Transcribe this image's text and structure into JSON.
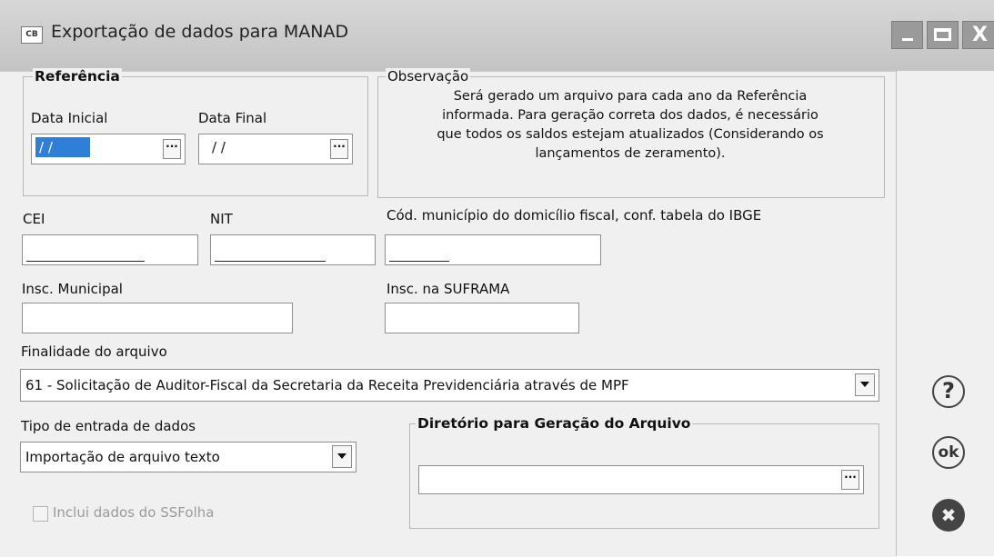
{
  "window": {
    "icon_text": "CB",
    "title": "Exportação de dados para MANAD"
  },
  "referencia": {
    "legend": "Referência",
    "data_inicial_label": "Data Inicial",
    "data_inicial_value": "/ /",
    "data_final_label": "Data Final",
    "data_final_value": "/ /",
    "picker_glyph": "···"
  },
  "observacao": {
    "legend": "Observação",
    "lines": [
      "Será gerado um arquivo para cada ano da Referência",
      "informada. Para geração correta dos dados, é necessário",
      "que todos os saldos estejam atualizados (Considerando os",
      "lançamentos de zeramento)."
    ]
  },
  "fields": {
    "cei_label": "CEI",
    "nit_label": "NIT",
    "cod_municipio_label": "Cód. município do domicílio fiscal, conf. tabela do IBGE",
    "insc_municipal_label": "Insc. Municipal",
    "insc_suframa_label": "Insc. na SUFRAMA"
  },
  "finalidade": {
    "label": "Finalidade do arquivo",
    "selected": "61 - Solicitação de Auditor-Fiscal da Secretaria da Receita Previdenciária através de MPF"
  },
  "tipo_entrada": {
    "label": "Tipo de entrada de dados",
    "selected": "Importação de arquivo texto"
  },
  "diretorio": {
    "legend": "Diretório para Geração do Arquivo",
    "value": ""
  },
  "ssfolha": {
    "label": "Inclui dados do SSFolha",
    "checked": false
  },
  "sidebar": {
    "help_glyph": "?",
    "ok_label": "ok",
    "cancel_glyph": "✖"
  }
}
